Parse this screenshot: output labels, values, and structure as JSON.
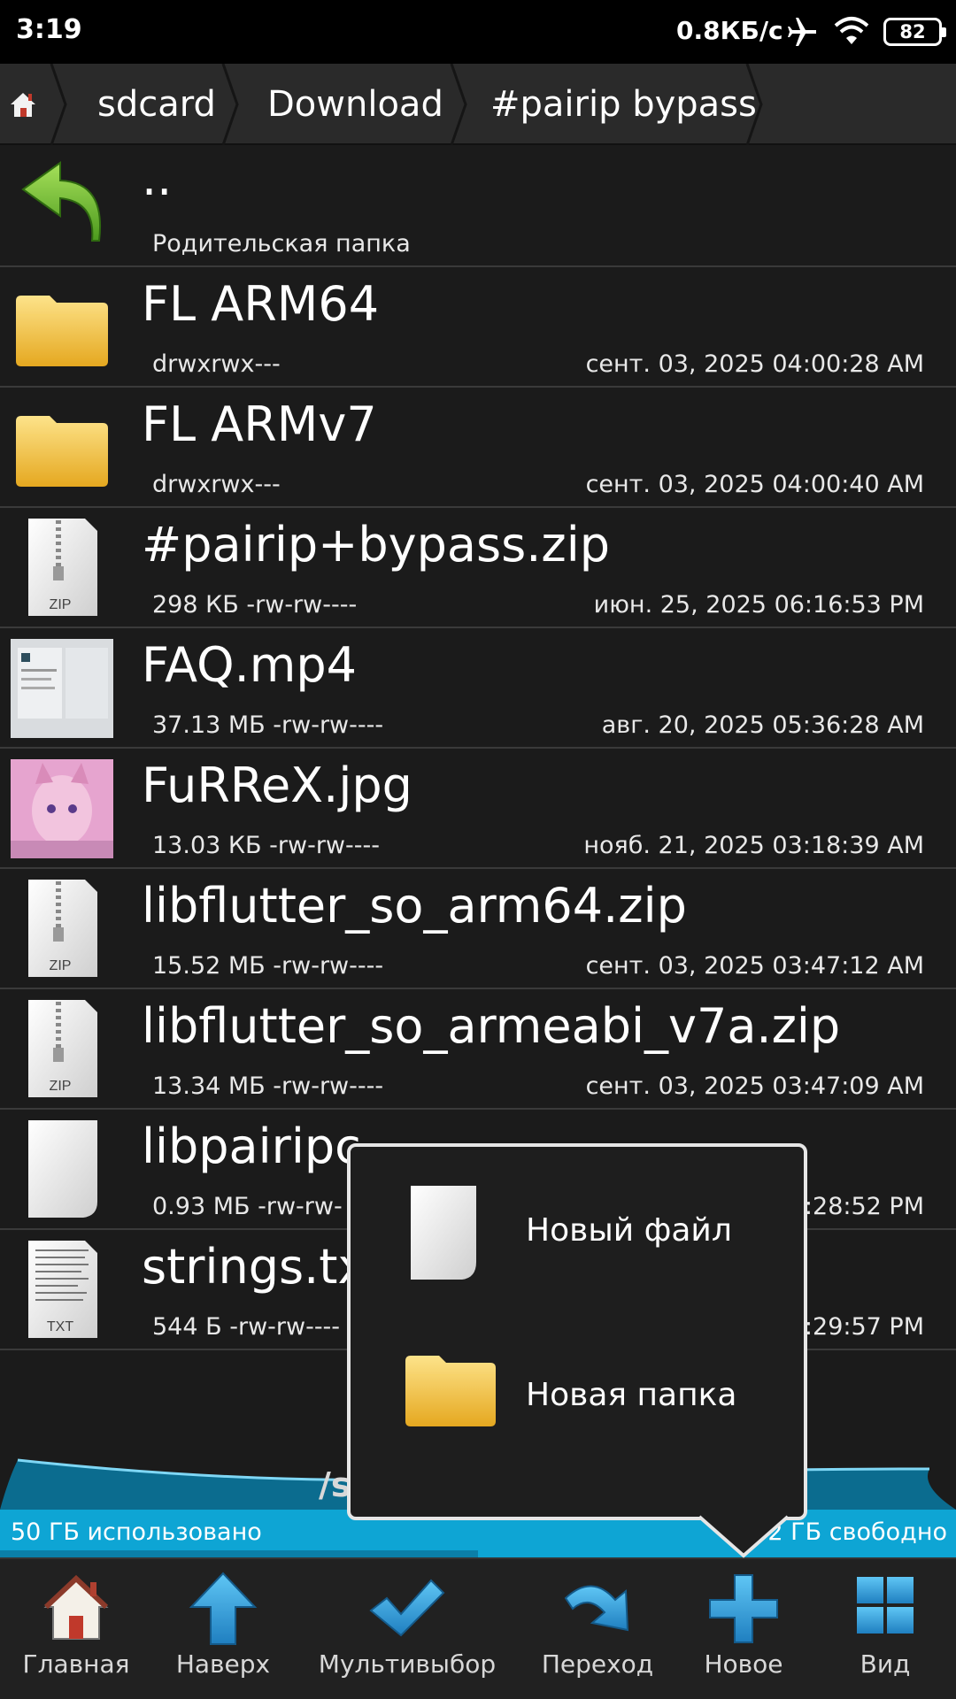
{
  "status_bar": {
    "time": "3:19",
    "net_speed": "0.8КБ/с",
    "battery": "82",
    "icons": [
      "airplane-icon",
      "wifi-icon",
      "battery-icon"
    ]
  },
  "breadcrumb": {
    "home_icon": "home-icon",
    "items": [
      "sdcard",
      "Download",
      "#pairip bypass"
    ]
  },
  "files": [
    {
      "name": "..",
      "meta": "Родительская папка",
      "date": "",
      "icon": "parent-folder-icon"
    },
    {
      "name": "FL ARM64",
      "meta": "drwxrwx---",
      "date": "сент. 03, 2025 04:00:28 AM",
      "icon": "folder-icon"
    },
    {
      "name": "FL ARMv7",
      "meta": "drwxrwx---",
      "date": "сент. 03, 2025 04:00:40 AM",
      "icon": "folder-icon"
    },
    {
      "name": "#pairip+bypass.zip",
      "meta": "298 КБ -rw-rw----",
      "date": "июн. 25, 2025 06:16:53 PM",
      "icon": "zip-file-icon"
    },
    {
      "name": "FAQ.mp4",
      "meta": "37.13 МБ -rw-rw----",
      "date": "авг. 20, 2025 05:36:28 AM",
      "icon": "video-thumbnail"
    },
    {
      "name": "FuRReX.jpg",
      "meta": "13.03 КБ -rw-rw----",
      "date": "нояб. 21, 2025 03:18:39 AM",
      "icon": "image-thumbnail"
    },
    {
      "name": "libflutter_so_arm64.zip",
      "meta": "15.52 МБ -rw-rw----",
      "date": "сент. 03, 2025 03:47:12 AM",
      "icon": "zip-file-icon"
    },
    {
      "name": "libflutter_so_armeabi_v7a.zip",
      "meta": "13.34 МБ -rw-rw----",
      "date": "сент. 03, 2025 03:47:09 AM",
      "icon": "zip-file-icon"
    },
    {
      "name": "libpairipc",
      "meta": "0.93 МБ -rw-rw-",
      "date": ":28:52 PM",
      "icon": "blank-file-icon"
    },
    {
      "name": "strings.tx",
      "meta": "544 Б -rw-rw----",
      "date": ":29:57 PM",
      "icon": "text-file-icon"
    }
  ],
  "path_label": "/s",
  "storage": {
    "used": "50 ГБ использовано",
    "free": "2 ГБ свободно",
    "used_fraction": 0.5
  },
  "toolbar": [
    {
      "label": "Главная",
      "icon": "home-icon"
    },
    {
      "label": "Наверх",
      "icon": "up-arrow-icon"
    },
    {
      "label": "Мультивыбор",
      "icon": "checkmark-icon"
    },
    {
      "label": "Переход",
      "icon": "jump-arrow-icon"
    },
    {
      "label": "Новое",
      "icon": "plus-icon"
    },
    {
      "label": "Вид",
      "icon": "grid-view-icon"
    }
  ],
  "new_popup": {
    "items": [
      {
        "label": "Новый файл",
        "icon": "new-file-icon"
      },
      {
        "label": "Новая папка",
        "icon": "new-folder-icon"
      }
    ]
  },
  "colors": {
    "accent": "#0ea5d4",
    "folder": "#f2c03a",
    "background": "#1b1b1b"
  }
}
